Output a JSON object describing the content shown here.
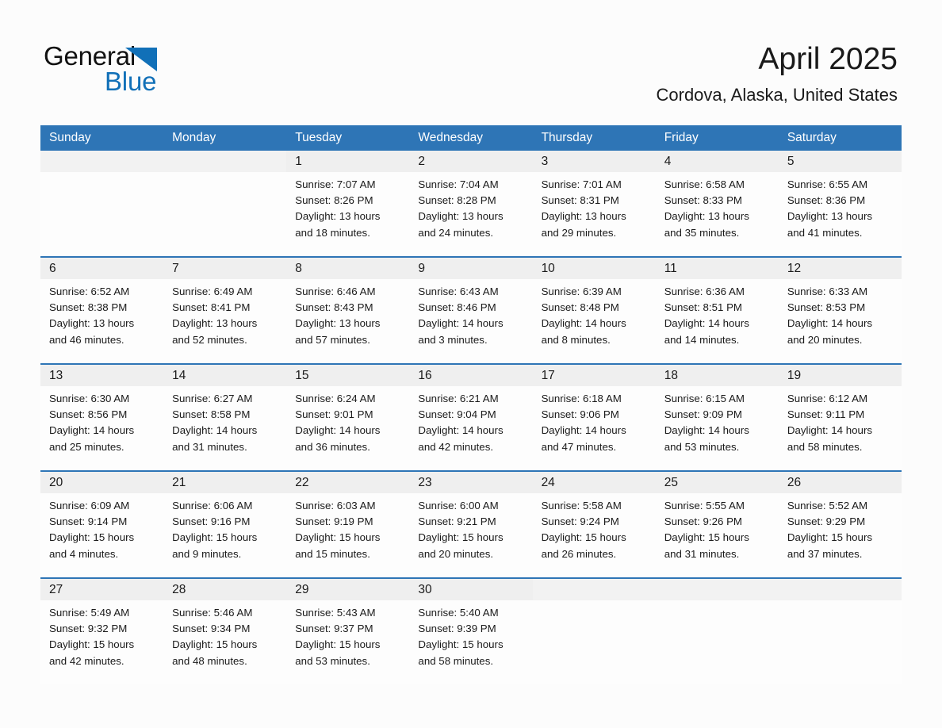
{
  "logo": {
    "word_one": "General",
    "word_two": "Blue",
    "triangle_icon": "triangle-icon",
    "brand_blue": "#1170b8"
  },
  "header": {
    "title": "April 2025",
    "subtitle": "Cordova, Alaska, United States"
  },
  "colors": {
    "header_blue": "#2e75b6",
    "row_divider_blue": "#2e75b6",
    "daynum_band": "#efefef",
    "cell_background": "#fdfdfd",
    "page_background": "#fcfcfc",
    "text": "#1a1a1a"
  },
  "calendar": {
    "weekday_headers": [
      "Sunday",
      "Monday",
      "Tuesday",
      "Wednesday",
      "Thursday",
      "Friday",
      "Saturday"
    ],
    "labels": {
      "sunrise": "Sunrise:",
      "sunset": "Sunset:",
      "daylight": "Daylight:"
    },
    "weeks": [
      [
        {
          "day": "",
          "empty": true
        },
        {
          "day": "",
          "empty": true
        },
        {
          "day": "1",
          "sunrise": "Sunrise: 7:07 AM",
          "sunset": "Sunset: 8:26 PM",
          "daylight_line1": "Daylight: 13 hours",
          "daylight_line2": "and 18 minutes."
        },
        {
          "day": "2",
          "sunrise": "Sunrise: 7:04 AM",
          "sunset": "Sunset: 8:28 PM",
          "daylight_line1": "Daylight: 13 hours",
          "daylight_line2": "and 24 minutes."
        },
        {
          "day": "3",
          "sunrise": "Sunrise: 7:01 AM",
          "sunset": "Sunset: 8:31 PM",
          "daylight_line1": "Daylight: 13 hours",
          "daylight_line2": "and 29 minutes."
        },
        {
          "day": "4",
          "sunrise": "Sunrise: 6:58 AM",
          "sunset": "Sunset: 8:33 PM",
          "daylight_line1": "Daylight: 13 hours",
          "daylight_line2": "and 35 minutes."
        },
        {
          "day": "5",
          "sunrise": "Sunrise: 6:55 AM",
          "sunset": "Sunset: 8:36 PM",
          "daylight_line1": "Daylight: 13 hours",
          "daylight_line2": "and 41 minutes."
        }
      ],
      [
        {
          "day": "6",
          "sunrise": "Sunrise: 6:52 AM",
          "sunset": "Sunset: 8:38 PM",
          "daylight_line1": "Daylight: 13 hours",
          "daylight_line2": "and 46 minutes."
        },
        {
          "day": "7",
          "sunrise": "Sunrise: 6:49 AM",
          "sunset": "Sunset: 8:41 PM",
          "daylight_line1": "Daylight: 13 hours",
          "daylight_line2": "and 52 minutes."
        },
        {
          "day": "8",
          "sunrise": "Sunrise: 6:46 AM",
          "sunset": "Sunset: 8:43 PM",
          "daylight_line1": "Daylight: 13 hours",
          "daylight_line2": "and 57 minutes."
        },
        {
          "day": "9",
          "sunrise": "Sunrise: 6:43 AM",
          "sunset": "Sunset: 8:46 PM",
          "daylight_line1": "Daylight: 14 hours",
          "daylight_line2": "and 3 minutes."
        },
        {
          "day": "10",
          "sunrise": "Sunrise: 6:39 AM",
          "sunset": "Sunset: 8:48 PM",
          "daylight_line1": "Daylight: 14 hours",
          "daylight_line2": "and 8 minutes."
        },
        {
          "day": "11",
          "sunrise": "Sunrise: 6:36 AM",
          "sunset": "Sunset: 8:51 PM",
          "daylight_line1": "Daylight: 14 hours",
          "daylight_line2": "and 14 minutes."
        },
        {
          "day": "12",
          "sunrise": "Sunrise: 6:33 AM",
          "sunset": "Sunset: 8:53 PM",
          "daylight_line1": "Daylight: 14 hours",
          "daylight_line2": "and 20 minutes."
        }
      ],
      [
        {
          "day": "13",
          "sunrise": "Sunrise: 6:30 AM",
          "sunset": "Sunset: 8:56 PM",
          "daylight_line1": "Daylight: 14 hours",
          "daylight_line2": "and 25 minutes."
        },
        {
          "day": "14",
          "sunrise": "Sunrise: 6:27 AM",
          "sunset": "Sunset: 8:58 PM",
          "daylight_line1": "Daylight: 14 hours",
          "daylight_line2": "and 31 minutes."
        },
        {
          "day": "15",
          "sunrise": "Sunrise: 6:24 AM",
          "sunset": "Sunset: 9:01 PM",
          "daylight_line1": "Daylight: 14 hours",
          "daylight_line2": "and 36 minutes."
        },
        {
          "day": "16",
          "sunrise": "Sunrise: 6:21 AM",
          "sunset": "Sunset: 9:04 PM",
          "daylight_line1": "Daylight: 14 hours",
          "daylight_line2": "and 42 minutes."
        },
        {
          "day": "17",
          "sunrise": "Sunrise: 6:18 AM",
          "sunset": "Sunset: 9:06 PM",
          "daylight_line1": "Daylight: 14 hours",
          "daylight_line2": "and 47 minutes."
        },
        {
          "day": "18",
          "sunrise": "Sunrise: 6:15 AM",
          "sunset": "Sunset: 9:09 PM",
          "daylight_line1": "Daylight: 14 hours",
          "daylight_line2": "and 53 minutes."
        },
        {
          "day": "19",
          "sunrise": "Sunrise: 6:12 AM",
          "sunset": "Sunset: 9:11 PM",
          "daylight_line1": "Daylight: 14 hours",
          "daylight_line2": "and 58 minutes."
        }
      ],
      [
        {
          "day": "20",
          "sunrise": "Sunrise: 6:09 AM",
          "sunset": "Sunset: 9:14 PM",
          "daylight_line1": "Daylight: 15 hours",
          "daylight_line2": "and 4 minutes."
        },
        {
          "day": "21",
          "sunrise": "Sunrise: 6:06 AM",
          "sunset": "Sunset: 9:16 PM",
          "daylight_line1": "Daylight: 15 hours",
          "daylight_line2": "and 9 minutes."
        },
        {
          "day": "22",
          "sunrise": "Sunrise: 6:03 AM",
          "sunset": "Sunset: 9:19 PM",
          "daylight_line1": "Daylight: 15 hours",
          "daylight_line2": "and 15 minutes."
        },
        {
          "day": "23",
          "sunrise": "Sunrise: 6:00 AM",
          "sunset": "Sunset: 9:21 PM",
          "daylight_line1": "Daylight: 15 hours",
          "daylight_line2": "and 20 minutes."
        },
        {
          "day": "24",
          "sunrise": "Sunrise: 5:58 AM",
          "sunset": "Sunset: 9:24 PM",
          "daylight_line1": "Daylight: 15 hours",
          "daylight_line2": "and 26 minutes."
        },
        {
          "day": "25",
          "sunrise": "Sunrise: 5:55 AM",
          "sunset": "Sunset: 9:26 PM",
          "daylight_line1": "Daylight: 15 hours",
          "daylight_line2": "and 31 minutes."
        },
        {
          "day": "26",
          "sunrise": "Sunrise: 5:52 AM",
          "sunset": "Sunset: 9:29 PM",
          "daylight_line1": "Daylight: 15 hours",
          "daylight_line2": "and 37 minutes."
        }
      ],
      [
        {
          "day": "27",
          "sunrise": "Sunrise: 5:49 AM",
          "sunset": "Sunset: 9:32 PM",
          "daylight_line1": "Daylight: 15 hours",
          "daylight_line2": "and 42 minutes."
        },
        {
          "day": "28",
          "sunrise": "Sunrise: 5:46 AM",
          "sunset": "Sunset: 9:34 PM",
          "daylight_line1": "Daylight: 15 hours",
          "daylight_line2": "and 48 minutes."
        },
        {
          "day": "29",
          "sunrise": "Sunrise: 5:43 AM",
          "sunset": "Sunset: 9:37 PM",
          "daylight_line1": "Daylight: 15 hours",
          "daylight_line2": "and 53 minutes."
        },
        {
          "day": "30",
          "sunrise": "Sunrise: 5:40 AM",
          "sunset": "Sunset: 9:39 PM",
          "daylight_line1": "Daylight: 15 hours",
          "daylight_line2": "and 58 minutes."
        },
        {
          "day": "",
          "empty": true
        },
        {
          "day": "",
          "empty": true
        },
        {
          "day": "",
          "empty": true
        }
      ]
    ]
  }
}
